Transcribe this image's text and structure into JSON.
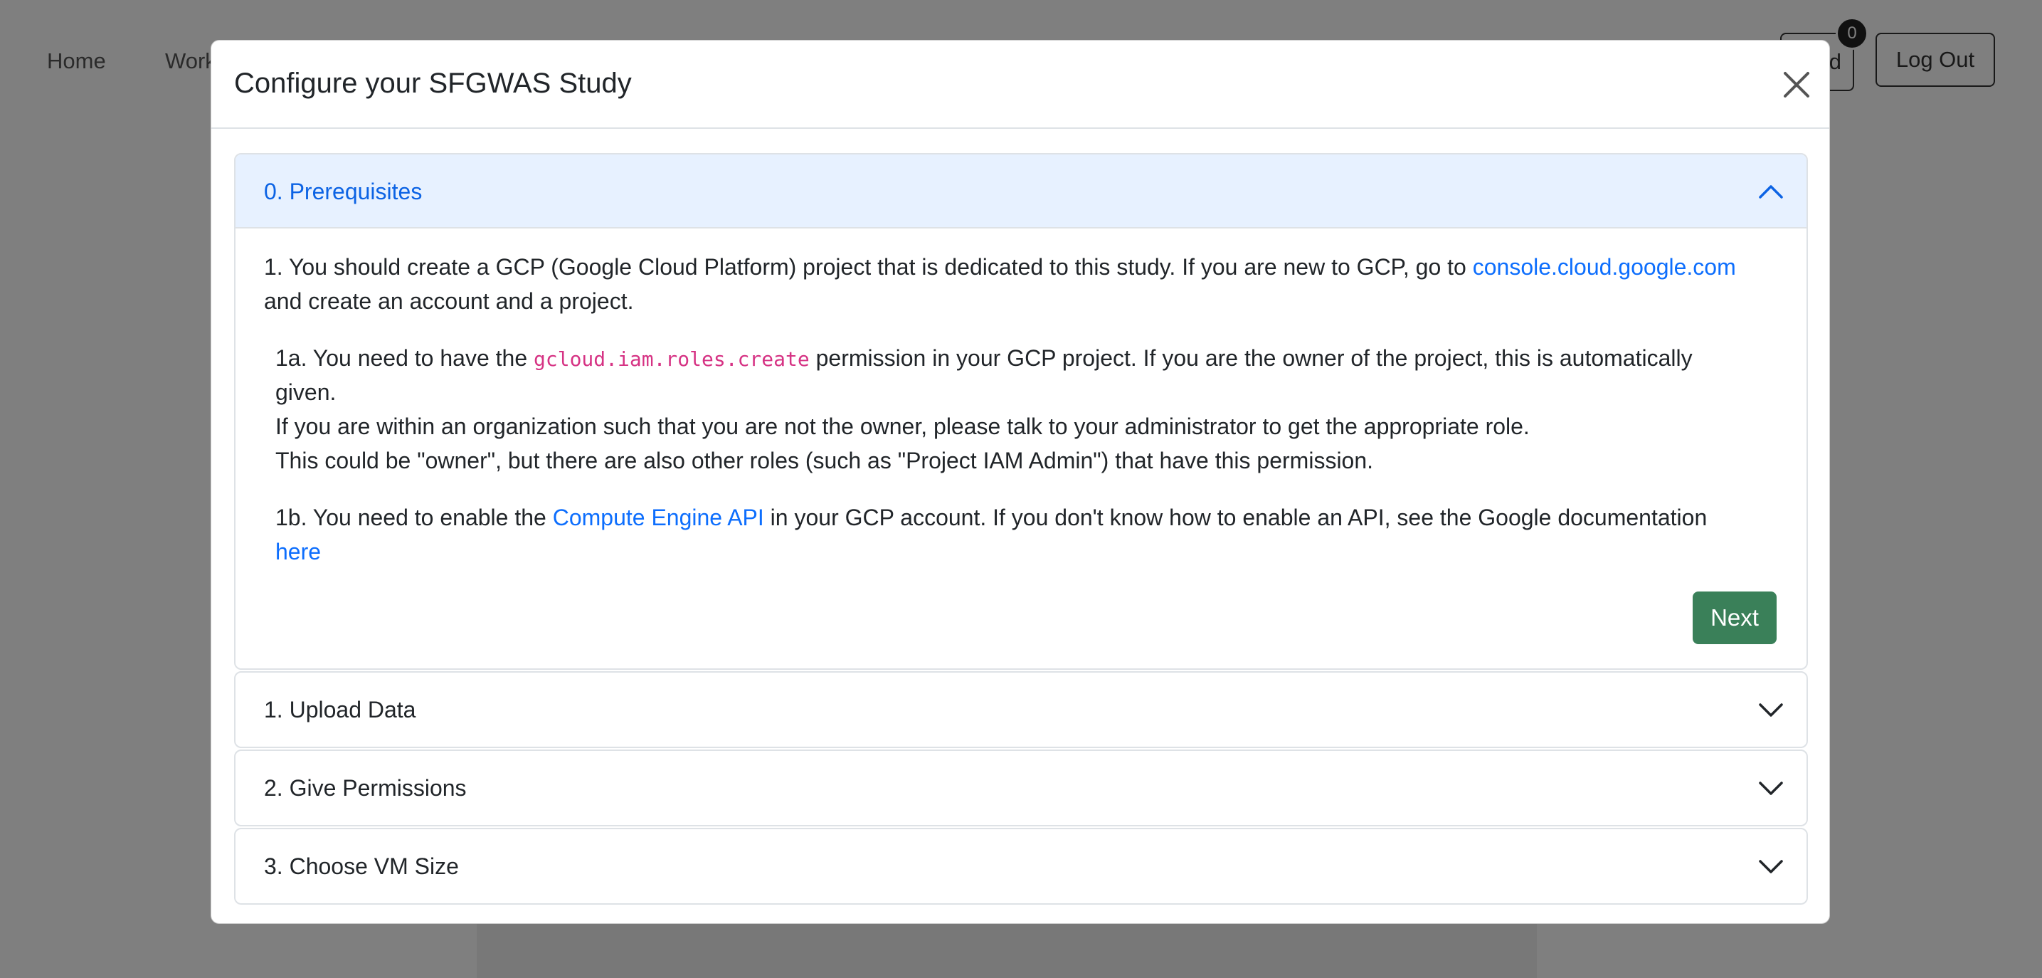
{
  "navbar": {
    "home": "Home",
    "work": "Work",
    "right_button_partial": "d",
    "badge_count": "0",
    "logout": "Log Out"
  },
  "modal": {
    "title": "Configure your SFGWAS Study",
    "accordion": [
      {
        "title": "0. Prerequisites",
        "expanded": true,
        "body": {
          "p1_part1": "1. You should create a GCP (Google Cloud Platform) project that is dedicated to this study. If you are new to GCP, go to ",
          "p1_link": "console.cloud.google.com",
          "p1_line2": "and create an account and a project.",
          "p1a_part1": "1a. You need to have the ",
          "p1a_code": "gcloud.iam.roles.create",
          "p1a_part2": " permission in your GCP project. If you are the owner of the project, this is automatically",
          "p1a_line2": "given.",
          "p1a_line3": "If you are within an organization such that you are not the owner, please talk to your administrator to get the appropriate role.",
          "p1a_line4": "This could be \"owner\", but there are also other roles (such as \"Project IAM Admin\") that have this permission.",
          "p1b_part1": "1b. You need to enable the ",
          "p1b_link": "Compute Engine API",
          "p1b_part2": " in your GCP account. If you don't know how to enable an API, see the Google documentation",
          "p1b_link2": "here",
          "next_label": "Next"
        }
      },
      {
        "title": "1. Upload Data",
        "expanded": false
      },
      {
        "title": "2. Give Permissions",
        "expanded": false
      },
      {
        "title": "3. Choose VM Size",
        "expanded": false
      }
    ]
  },
  "colors": {
    "accent_link": "#0d6efd",
    "active_header_bg": "#e7f1ff",
    "next_button": "#3a8059",
    "code_text": "#d63384"
  }
}
